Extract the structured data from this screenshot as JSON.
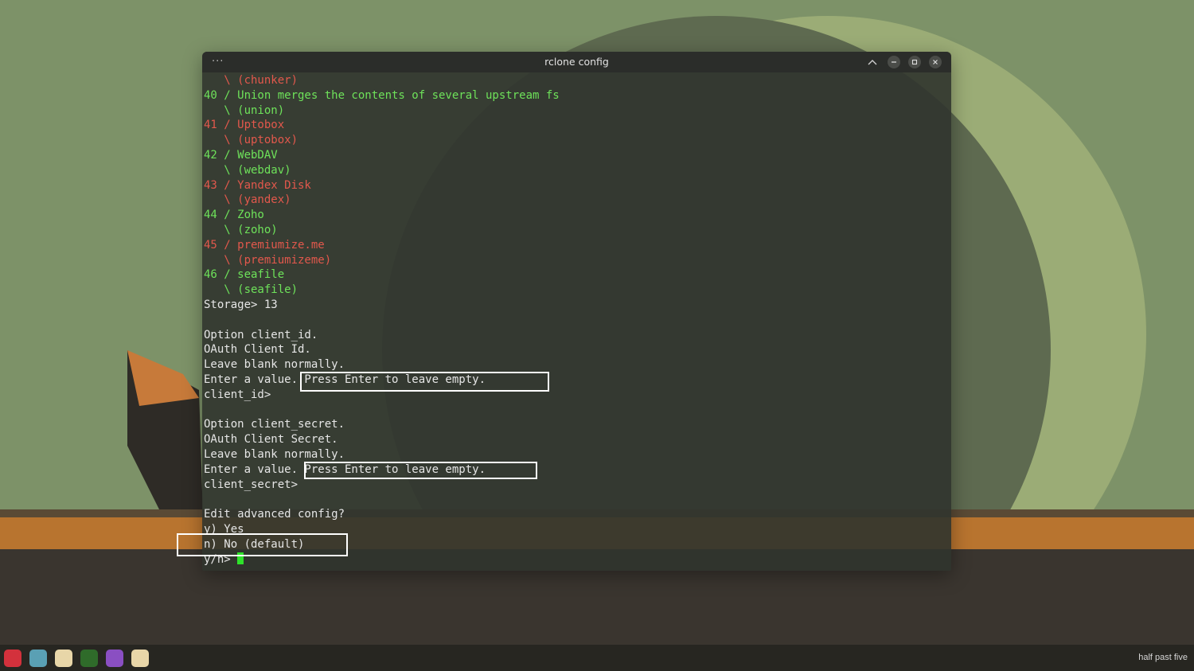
{
  "window": {
    "title": "rclone config",
    "menu_glyph": "···"
  },
  "terminal": {
    "lines": [
      {
        "text": "   \\ (chunker)",
        "color": "red"
      },
      {
        "text": "40 / Union merges the contents of several upstream fs",
        "color": "green"
      },
      {
        "text": "   \\ (union)",
        "color": "green"
      },
      {
        "text": "41 / Uptobox",
        "color": "red"
      },
      {
        "text": "   \\ (uptobox)",
        "color": "red"
      },
      {
        "text": "42 / WebDAV",
        "color": "green"
      },
      {
        "text": "   \\ (webdav)",
        "color": "green"
      },
      {
        "text": "43 / Yandex Disk",
        "color": "red"
      },
      {
        "text": "   \\ (yandex)",
        "color": "red"
      },
      {
        "text": "44 / Zoho",
        "color": "green"
      },
      {
        "text": "   \\ (zoho)",
        "color": "green"
      },
      {
        "text": "45 / premiumize.me",
        "color": "red"
      },
      {
        "text": "   \\ (premiumizeme)",
        "color": "red"
      },
      {
        "text": "46 / seafile",
        "color": "green"
      },
      {
        "text": "   \\ (seafile)",
        "color": "green"
      },
      {
        "text": "Storage> 13",
        "color": "white"
      },
      {
        "text": "",
        "color": "white"
      },
      {
        "text": "Option client_id.",
        "color": "white"
      },
      {
        "text": "OAuth Client Id.",
        "color": "white"
      },
      {
        "text": "Leave blank normally.",
        "color": "white"
      },
      {
        "text": "Enter a value. Press Enter to leave empty.",
        "color": "white"
      },
      {
        "text": "client_id>",
        "color": "white"
      },
      {
        "text": "",
        "color": "white"
      },
      {
        "text": "Option client_secret.",
        "color": "white"
      },
      {
        "text": "OAuth Client Secret.",
        "color": "white"
      },
      {
        "text": "Leave blank normally.",
        "color": "white"
      },
      {
        "text": "Enter a value. Press Enter to leave empty.",
        "color": "white"
      },
      {
        "text": "client_secret>",
        "color": "white"
      },
      {
        "text": "",
        "color": "white"
      },
      {
        "text": "Edit advanced config?",
        "color": "white"
      },
      {
        "text": "y) Yes",
        "color": "white"
      },
      {
        "text": "n) No (default)",
        "color": "white"
      }
    ],
    "prompt": "y/n> ",
    "colors": {
      "red": "#e2584c",
      "green": "#6ee25a",
      "white": "#e6e6e6",
      "cursor": "#2ee22a"
    }
  },
  "taskbar": {
    "apps": [
      {
        "name": "debian-icon",
        "color": "#d3313c"
      },
      {
        "name": "files-icon",
        "color": "#5aa0b4"
      },
      {
        "name": "cat-icon",
        "color": "#e8d6a8"
      },
      {
        "name": "ccleaner-icon",
        "color": "#2f6b2a"
      },
      {
        "name": "browser-icon",
        "color": "#8a4fc2"
      },
      {
        "name": "cat-icon",
        "color": "#e8d6a8"
      }
    ],
    "clock": "half past five"
  }
}
